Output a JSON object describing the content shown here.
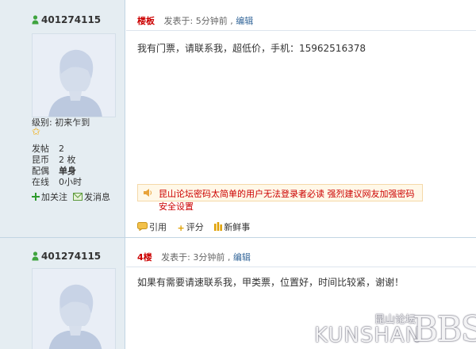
{
  "posts": [
    {
      "username": "401274115",
      "level_label": "级别:",
      "level_value": "初来乍到",
      "stats": [
        {
          "k": "发帖",
          "v": "2"
        },
        {
          "k": "昆币",
          "v": "2 枚"
        },
        {
          "k": "配偶",
          "v": "单身"
        },
        {
          "k": "在线",
          "v": "0小时"
        }
      ],
      "follow_label": "加关注",
      "message_label": "发消息",
      "floor": "楼板",
      "posted": "发表于: 5分钟前",
      "edit": "编辑",
      "content": "我有门票，请联系我，超低价，手机：15962516378",
      "notice": "昆山论坛密码太简单的用户无法登录者必读 强烈建议网友加强密码安全设置",
      "actions": [
        "引用",
        "评分",
        "新鲜事"
      ]
    },
    {
      "username": "401274115",
      "floor": "4楼",
      "posted": "发表于: 3分钟前",
      "edit": "编辑",
      "content": "如果有需要请速联系我，甲类票，位置好，时间比较紧，谢谢！"
    }
  ],
  "watermark": {
    "latin": "KUNSHAN",
    "chinese": "昆山论坛",
    "bbs": "BBS"
  },
  "colors": {
    "sidebar_bg": "#e5edf2",
    "border": "#c2d5e3",
    "link": "#336699",
    "floor": "#cc0000",
    "notice_text": "#cc0000"
  }
}
